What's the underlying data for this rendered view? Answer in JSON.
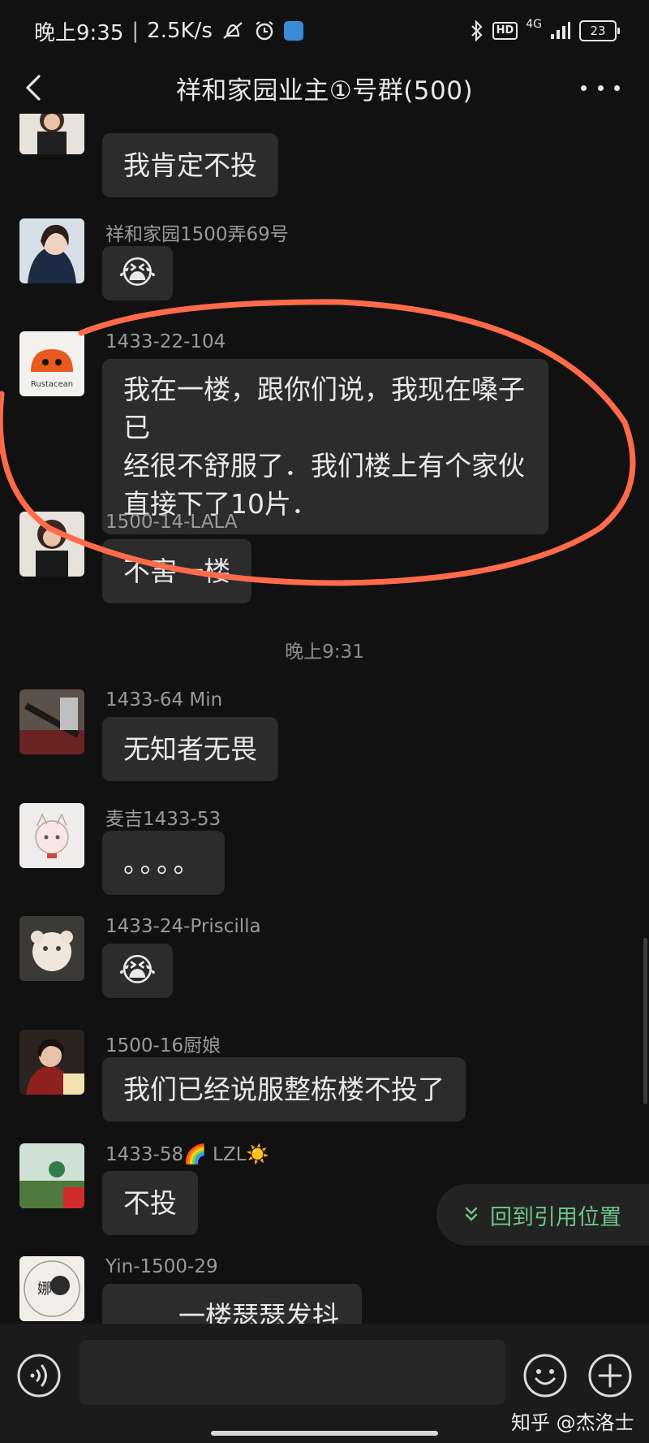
{
  "status_bar": {
    "time": "晚上9:35",
    "speed": "2.5K/s",
    "separator": "|",
    "hd": "HD",
    "network": "4G",
    "battery": "23"
  },
  "header": {
    "title": "祥和家园业主①号群(500)"
  },
  "messages": [
    {
      "sender": "",
      "text": "我肯定不投"
    },
    {
      "sender": "祥和家园1500弄69号",
      "text": "😭"
    },
    {
      "sender": "1433-22-104",
      "text": "我在一楼，跟你们说，我现在嗓子已经很不舒服了．我们楼上有个家伙直接下了10片．",
      "lines": [
        "我在一楼，跟你们说，我现在嗓子已",
        "经很不舒服了．我们楼上有个家伙",
        "直接下了10片．"
      ],
      "avatar_text": "Rustacean"
    },
    {
      "sender": "1500-14-LALA",
      "text": "不害一楼"
    },
    {
      "time": "晚上9:31"
    },
    {
      "sender": "1433-64 Min",
      "text": "无知者无畏"
    },
    {
      "sender": "麦吉1433-53",
      "text": "。。。。"
    },
    {
      "sender": "1433-24-Priscilla",
      "text": "😭"
    },
    {
      "sender": "1500-16厨娘",
      "text": "我们已经说服整栋楼不投了"
    },
    {
      "sender": "1433-58🌈 LZL☀️",
      "text": "不投"
    },
    {
      "sender": "Yin-1500-29",
      "text": "一楼瑟瑟发抖",
      "avatar_text": "娜"
    }
  ],
  "quote_button": {
    "label": "回到引用位置"
  },
  "input_bar": {
    "placeholder": ""
  },
  "watermark": "知乎 @杰洛士",
  "colors": {
    "background": "#111111",
    "bubble": "#2c2c2c",
    "annotation": "#ff6b4a",
    "accent_green": "#6cc38a"
  }
}
